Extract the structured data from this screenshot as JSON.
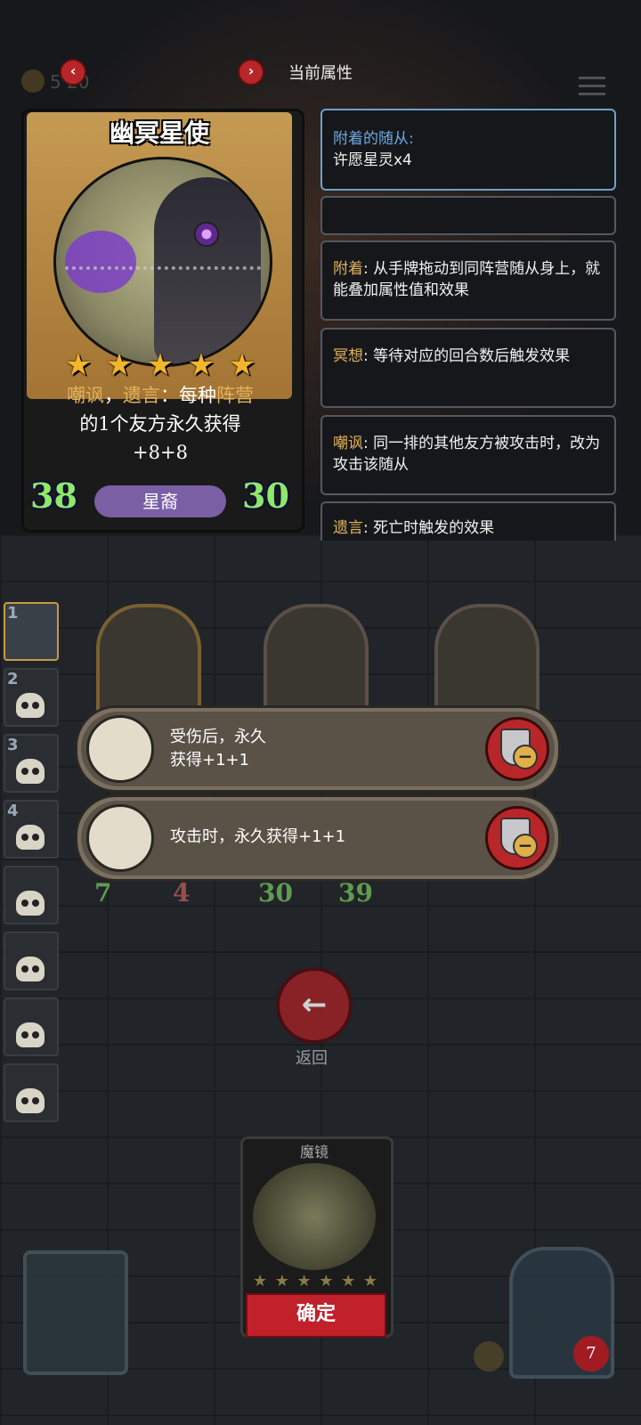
{
  "header": {
    "title": "当前属性",
    "prev_icon": "chevron-left-icon",
    "next_icon": "chevron-right-icon",
    "prev_symbol": "‹",
    "next_symbol": "›",
    "coins": "5 20"
  },
  "card": {
    "name": "幽冥星使",
    "stars": 5,
    "star_symbol": "★",
    "desc_parts": {
      "kw1": "嘲讽",
      "sep1": "，",
      "kw2": "遗言",
      "sep2": "：每种",
      "kw3": "阵营",
      "rest": "的1个友方永久获得",
      "bonus": "+8+8"
    },
    "attack": "38",
    "health": "30",
    "tribe": "星裔"
  },
  "info_panels": {
    "attached": {
      "label": "附着的随从:",
      "value": "许愿星灵x4"
    },
    "attach_rule": {
      "term": "附着",
      "text": ": 从手牌拖动到同阵营随从身上，就能叠加属性值和效果"
    },
    "meditate_rule": {
      "term": "冥想",
      "text": ": 等待对应的回合数后触发效果"
    },
    "taunt_rule": {
      "term": "嘲讽",
      "text": ": 同一排的其他友方被攻击时，改为攻击该随从"
    },
    "deathrattle_rule": {
      "term": "遗言",
      "text": ": 死亡时触发的效果"
    }
  },
  "side_slots": [
    "1",
    "2",
    "3",
    "4",
    "",
    "",
    "",
    ""
  ],
  "board": {
    "left_attack": "7",
    "left_health": "4",
    "mid_attack": "30",
    "mid_health": "39"
  },
  "effects": [
    {
      "icon": "candelabra-icon",
      "line1": "受伤后，永久",
      "line2": "获得+1+1"
    },
    {
      "icon": "axe-icon",
      "line1": "攻击时，永久获得+1+1",
      "line2": ""
    }
  ],
  "back": {
    "symbol": "←",
    "label": "返回"
  },
  "bottom_card": {
    "name": "魔镜",
    "confirm": "确定",
    "star_symbol": "★"
  },
  "player": {
    "health": "7"
  },
  "colors": {
    "accent_red": "#c0212a",
    "keyword_gold": "#e3b25b",
    "stat_green": "#8ee86a",
    "tribe_purple": "#7a5fa5",
    "label_blue": "#6fa9e0"
  }
}
